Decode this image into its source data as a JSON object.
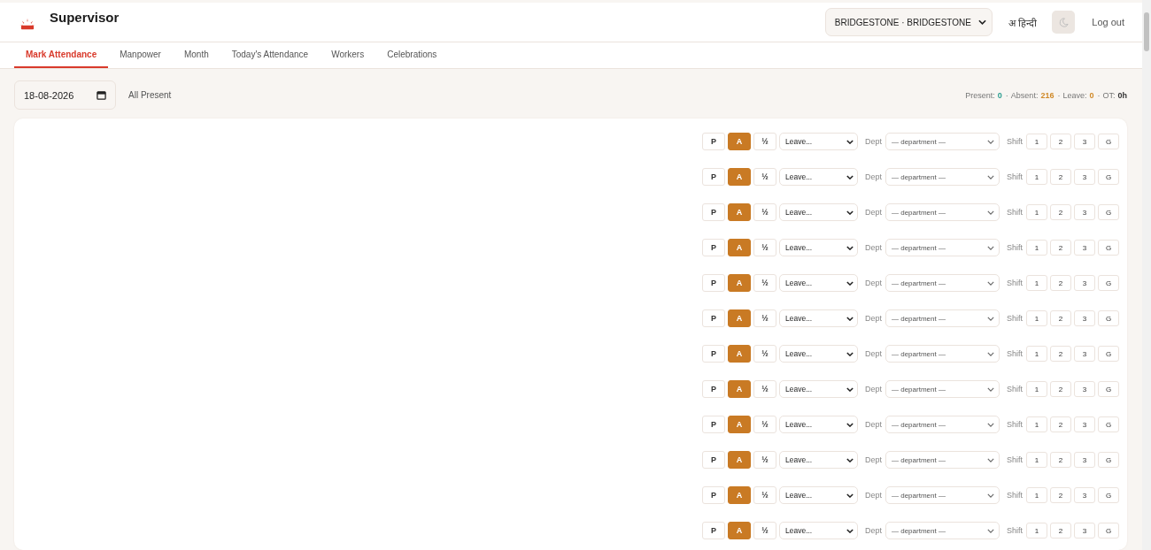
{
  "header": {
    "title": "Supervisor",
    "company_select": "BRIDGESTONE · BRIDGESTONE",
    "language_button": "अ हिन्दी",
    "dark_mode_on": false,
    "logout": "Log out"
  },
  "tabs": [
    {
      "label": "Mark Attendance",
      "selected": true
    },
    {
      "label": "Manpower",
      "selected": false
    },
    {
      "label": "Month",
      "selected": false
    },
    {
      "label": "Today's Attendance",
      "selected": false
    },
    {
      "label": "Workers",
      "selected": false
    },
    {
      "label": "Celebrations",
      "selected": false
    }
  ],
  "toolbar": {
    "date": "18-08-2026",
    "all_present": "All Present",
    "separator": "·",
    "summary": [
      {
        "label": "Present:",
        "value": "0",
        "color": "#2a9d8f"
      },
      {
        "label": "Absent:",
        "value": "216",
        "color": "#d08a2a"
      },
      {
        "label": "Leave:",
        "value": "0",
        "color": "#d08a2a"
      },
      {
        "label": "OT:",
        "value": "0h",
        "color": "#333333"
      }
    ]
  },
  "rows": [
    {
      "status": [
        {
          "label": "P",
          "selected": false
        },
        {
          "label": "A",
          "selected": true
        },
        {
          "label": "½",
          "selected": false
        }
      ],
      "leave": "Leave...",
      "dept_label": "Dept",
      "dept": "— department —",
      "shift_label": "Shift",
      "shifts": [
        {
          "label": "1",
          "selected": false
        },
        {
          "label": "2",
          "selected": false
        },
        {
          "label": "3",
          "selected": false
        },
        {
          "label": "G",
          "selected": false
        }
      ]
    },
    {
      "status": [
        {
          "label": "P",
          "selected": false
        },
        {
          "label": "A",
          "selected": true
        },
        {
          "label": "½",
          "selected": false
        }
      ],
      "leave": "Leave...",
      "dept_label": "Dept",
      "dept": "— department —",
      "shift_label": "Shift",
      "shifts": [
        {
          "label": "1",
          "selected": false
        },
        {
          "label": "2",
          "selected": false
        },
        {
          "label": "3",
          "selected": false
        },
        {
          "label": "G",
          "selected": false
        }
      ]
    },
    {
      "status": [
        {
          "label": "P",
          "selected": false
        },
        {
          "label": "A",
          "selected": true
        },
        {
          "label": "½",
          "selected": false
        }
      ],
      "leave": "Leave...",
      "dept_label": "Dept",
      "dept": "— department —",
      "shift_label": "Shift",
      "shifts": [
        {
          "label": "1",
          "selected": false
        },
        {
          "label": "2",
          "selected": false
        },
        {
          "label": "3",
          "selected": false
        },
        {
          "label": "G",
          "selected": false
        }
      ]
    },
    {
      "status": [
        {
          "label": "P",
          "selected": false
        },
        {
          "label": "A",
          "selected": true
        },
        {
          "label": "½",
          "selected": false
        }
      ],
      "leave": "Leave...",
      "dept_label": "Dept",
      "dept": "— department —",
      "shift_label": "Shift",
      "shifts": [
        {
          "label": "1",
          "selected": false
        },
        {
          "label": "2",
          "selected": false
        },
        {
          "label": "3",
          "selected": false
        },
        {
          "label": "G",
          "selected": false
        }
      ]
    },
    {
      "status": [
        {
          "label": "P",
          "selected": false
        },
        {
          "label": "A",
          "selected": true
        },
        {
          "label": "½",
          "selected": false
        }
      ],
      "leave": "Leave...",
      "dept_label": "Dept",
      "dept": "— department —",
      "shift_label": "Shift",
      "shifts": [
        {
          "label": "1",
          "selected": false
        },
        {
          "label": "2",
          "selected": false
        },
        {
          "label": "3",
          "selected": false
        },
        {
          "label": "G",
          "selected": false
        }
      ]
    },
    {
      "status": [
        {
          "label": "P",
          "selected": false
        },
        {
          "label": "A",
          "selected": true
        },
        {
          "label": "½",
          "selected": false
        }
      ],
      "leave": "Leave...",
      "dept_label": "Dept",
      "dept": "— department —",
      "shift_label": "Shift",
      "shifts": [
        {
          "label": "1",
          "selected": false
        },
        {
          "label": "2",
          "selected": false
        },
        {
          "label": "3",
          "selected": false
        },
        {
          "label": "G",
          "selected": false
        }
      ]
    },
    {
      "status": [
        {
          "label": "P",
          "selected": false
        },
        {
          "label": "A",
          "selected": true
        },
        {
          "label": "½",
          "selected": false
        }
      ],
      "leave": "Leave...",
      "dept_label": "Dept",
      "dept": "— department —",
      "shift_label": "Shift",
      "shifts": [
        {
          "label": "1",
          "selected": false
        },
        {
          "label": "2",
          "selected": false
        },
        {
          "label": "3",
          "selected": false
        },
        {
          "label": "G",
          "selected": false
        }
      ]
    },
    {
      "status": [
        {
          "label": "P",
          "selected": false
        },
        {
          "label": "A",
          "selected": true
        },
        {
          "label": "½",
          "selected": false
        }
      ],
      "leave": "Leave...",
      "dept_label": "Dept",
      "dept": "— department —",
      "shift_label": "Shift",
      "shifts": [
        {
          "label": "1",
          "selected": false
        },
        {
          "label": "2",
          "selected": false
        },
        {
          "label": "3",
          "selected": false
        },
        {
          "label": "G",
          "selected": false
        }
      ]
    },
    {
      "status": [
        {
          "label": "P",
          "selected": false
        },
        {
          "label": "A",
          "selected": true
        },
        {
          "label": "½",
          "selected": false
        }
      ],
      "leave": "Leave...",
      "dept_label": "Dept",
      "dept": "— department —",
      "shift_label": "Shift",
      "shifts": [
        {
          "label": "1",
          "selected": false
        },
        {
          "label": "2",
          "selected": false
        },
        {
          "label": "3",
          "selected": false
        },
        {
          "label": "G",
          "selected": false
        }
      ]
    },
    {
      "status": [
        {
          "label": "P",
          "selected": false
        },
        {
          "label": "A",
          "selected": true
        },
        {
          "label": "½",
          "selected": false
        }
      ],
      "leave": "Leave...",
      "dept_label": "Dept",
      "dept": "— department —",
      "shift_label": "Shift",
      "shifts": [
        {
          "label": "1",
          "selected": false
        },
        {
          "label": "2",
          "selected": false
        },
        {
          "label": "3",
          "selected": false
        },
        {
          "label": "G",
          "selected": false
        }
      ]
    },
    {
      "status": [
        {
          "label": "P",
          "selected": false
        },
        {
          "label": "A",
          "selected": true
        },
        {
          "label": "½",
          "selected": false
        }
      ],
      "leave": "Leave...",
      "dept_label": "Dept",
      "dept": "— department —",
      "shift_label": "Shift",
      "shifts": [
        {
          "label": "1",
          "selected": false
        },
        {
          "label": "2",
          "selected": false
        },
        {
          "label": "3",
          "selected": false
        },
        {
          "label": "G",
          "selected": false
        }
      ]
    },
    {
      "status": [
        {
          "label": "P",
          "selected": false
        },
        {
          "label": "A",
          "selected": true
        },
        {
          "label": "½",
          "selected": false
        }
      ],
      "leave": "Leave...",
      "dept_label": "Dept",
      "dept": "— department —",
      "shift_label": "Shift",
      "shifts": [
        {
          "label": "1",
          "selected": false
        },
        {
          "label": "2",
          "selected": false
        },
        {
          "label": "3",
          "selected": false
        },
        {
          "label": "G",
          "selected": false
        }
      ]
    }
  ]
}
